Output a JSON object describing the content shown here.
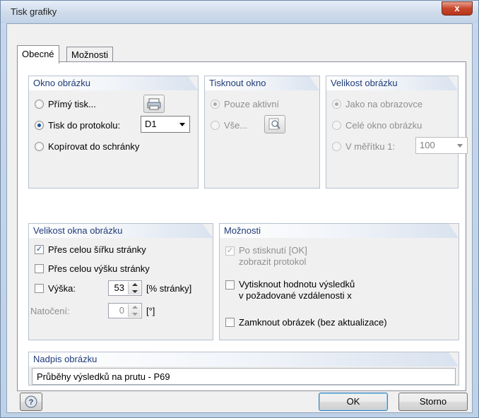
{
  "window": {
    "title": "Tisk grafiky",
    "close_label": "x"
  },
  "tabs": [
    {
      "label": "Obecné",
      "active": true
    },
    {
      "label": "Možnosti",
      "active": false
    }
  ],
  "okno_obrazku": {
    "title": "Okno obrázku",
    "direct_print": "Přímý tisk...",
    "print_to_report": "Tisk do protokolu:",
    "report_value": "D1",
    "copy_to_clipboard": "Kopírovat do schránky",
    "selected": "print_to_report"
  },
  "tisknout_okno": {
    "title": "Tisknout okno",
    "only_active": "Pouze aktivní",
    "all": "Vše...",
    "selected": "only_active"
  },
  "velikost_obrazku": {
    "title": "Velikost obrázku",
    "as_screen": "Jako na obrazovce",
    "whole_window": "Celé okno obrázku",
    "scale_label": "V měřítku 1:",
    "scale_value": "100",
    "selected": "as_screen"
  },
  "velikost_okna": {
    "title": "Velikost okna obrázku",
    "full_width": "Přes celou šířku stránky",
    "full_width_checked": true,
    "full_height": "Přes celou výšku stránky",
    "full_height_checked": false,
    "height_label": "Výška:",
    "height_checked": false,
    "height_value": "53",
    "height_unit": "[% stránky]",
    "rotation_label": "Natočení:",
    "rotation_value": "0",
    "rotation_unit": "[°]"
  },
  "moznosti": {
    "title": "Možnosti",
    "show_report_line1": "Po stisknutí [OK]",
    "show_report_line2": "zobrazit protokol",
    "show_report_checked": true,
    "print_values_line1": "Vytisknout hodnotu výsledků",
    "print_values_line2": "v požadované vzdálenosti x",
    "print_values_checked": false,
    "lock_image": "Zamknout obrázek (bez aktualizace)",
    "lock_image_checked": false
  },
  "nadpis": {
    "title": "Nadpis obrázku",
    "value": "Průběhy výsledků na prutu -  P69"
  },
  "footer": {
    "ok": "OK",
    "cancel": "Storno"
  },
  "icons": {
    "printer": "printer-icon",
    "search": "magnifier-icon",
    "help": "help-icon"
  }
}
